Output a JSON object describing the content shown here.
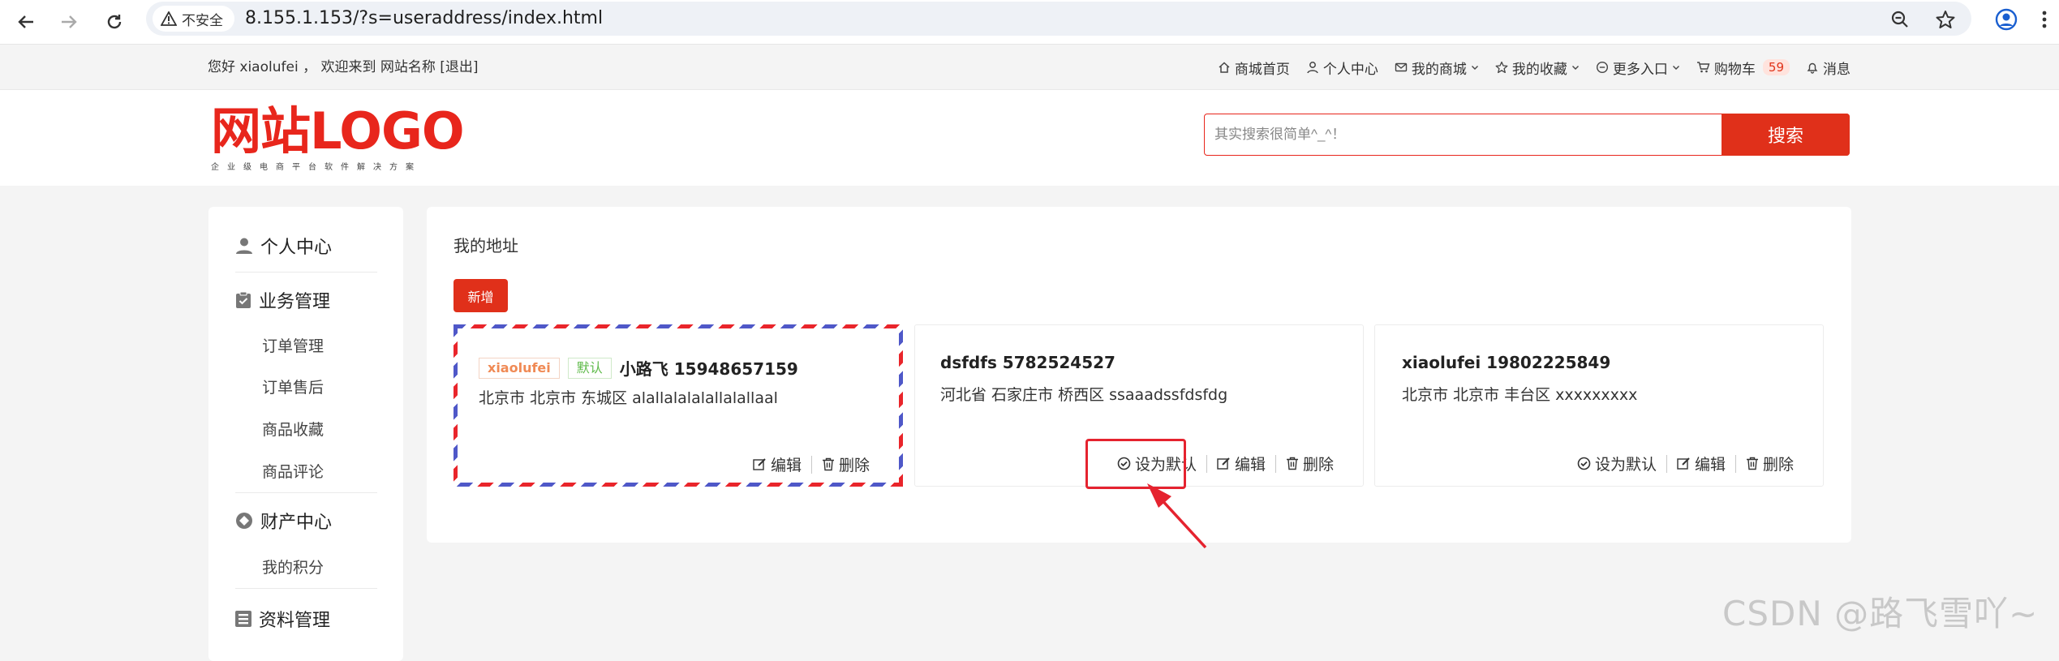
{
  "browser": {
    "security_label": "不安全",
    "url": "8.155.1.153/?s=useraddress/index.html"
  },
  "topbar": {
    "greeting": "您好 xiaolufei ， 欢迎来到 网站名称 [退出]",
    "links": {
      "home": "商城首页",
      "personal": "个人中心",
      "my_mall": "我的商城",
      "favorites": "我的收藏",
      "more": "更多入口",
      "cart": "购物车",
      "cart_count": "59",
      "messages": "消息"
    }
  },
  "header": {
    "logo_text": "网站LOGO",
    "logo_sub": "企业级电商平台软件解决方案",
    "search_placeholder": "其实搜索很简单^_^！",
    "search_button": "搜索"
  },
  "sidebar": {
    "personal_center": "个人中心",
    "business": "业务管理",
    "business_items": [
      "订单管理",
      "订单售后",
      "商品收藏",
      "商品评论"
    ],
    "assets": "财产中心",
    "assets_items": [
      "我的积分"
    ],
    "profile": "资料管理"
  },
  "main": {
    "title": "我的地址",
    "add_button": "新增",
    "actions": {
      "set_default": "设为默认",
      "edit": "编辑",
      "delete": "删除"
    },
    "addresses": [
      {
        "tag_name": "xiaolufei",
        "tag_default": "默认",
        "recipient": "小路飞 15948657159",
        "address": "北京市 北京市 东城区 alallalalalallalallaal",
        "is_default": true
      },
      {
        "recipient": "dsfdfs 5782524527",
        "address": "河北省 石家庄市 桥西区 ssaaadssfdsfdg",
        "is_default": false
      },
      {
        "recipient": "xiaolufei 19802225849",
        "address": "北京市 北京市 丰台区 xxxxxxxxx",
        "is_default": false
      }
    ]
  },
  "watermark": "CSDN @路飞雪吖~",
  "colors": {
    "brand_red": "#e0301a",
    "logo_red": "#e8261c",
    "airmail_red": "#e9252b",
    "airmail_blue": "#4f58c8",
    "default_tag_green": "#5fba4a",
    "annotation_red": "#e5232f"
  }
}
